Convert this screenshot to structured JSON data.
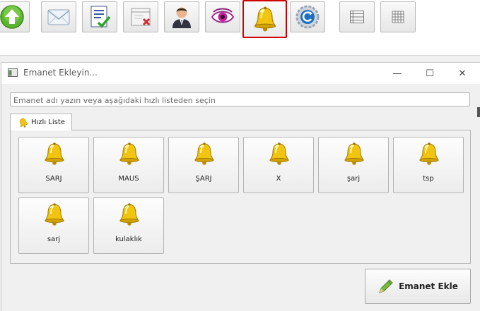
{
  "toolbar": {
    "buttons": [
      {
        "icon": "green-up-arrow-icon"
      },
      {
        "icon": "envelope-icon"
      },
      {
        "icon": "checklist-icon"
      },
      {
        "icon": "delete-list-icon"
      },
      {
        "icon": "person-icon"
      },
      {
        "icon": "eye-icon"
      },
      {
        "icon": "bell-icon",
        "selected": true
      },
      {
        "icon": "gear-refresh-icon"
      },
      {
        "icon": "list-view-icon"
      },
      {
        "icon": "grid-view-icon"
      }
    ]
  },
  "dialog": {
    "title": "Emanet Ekleyin...",
    "controls": {
      "minimize": "—",
      "maximize": "☐",
      "close": "✕"
    },
    "search": {
      "placeholder": "Emanet adı yazın veya aşağıdaki hızlı listeden seçin",
      "value": ""
    },
    "tab": {
      "label": "Hızlı Liste",
      "icon": "bell-icon"
    },
    "items": [
      {
        "label": "SARJ",
        "icon": "bell-icon"
      },
      {
        "label": "MAUS",
        "icon": "bell-icon"
      },
      {
        "label": "ŞARJ",
        "icon": "bell-icon"
      },
      {
        "label": "X",
        "icon": "bell-icon"
      },
      {
        "label": "şarj",
        "icon": "bell-icon"
      },
      {
        "label": "tsp",
        "icon": "bell-icon"
      },
      {
        "label": "sarj",
        "icon": "bell-icon"
      },
      {
        "label": "kulaklık",
        "icon": "bell-icon"
      }
    ],
    "add_button": {
      "label": "Emanet Ekle",
      "icon": "pencil-icon"
    }
  },
  "colors": {
    "selected_border": "#d00000",
    "bell_gold": "#e8b800"
  }
}
